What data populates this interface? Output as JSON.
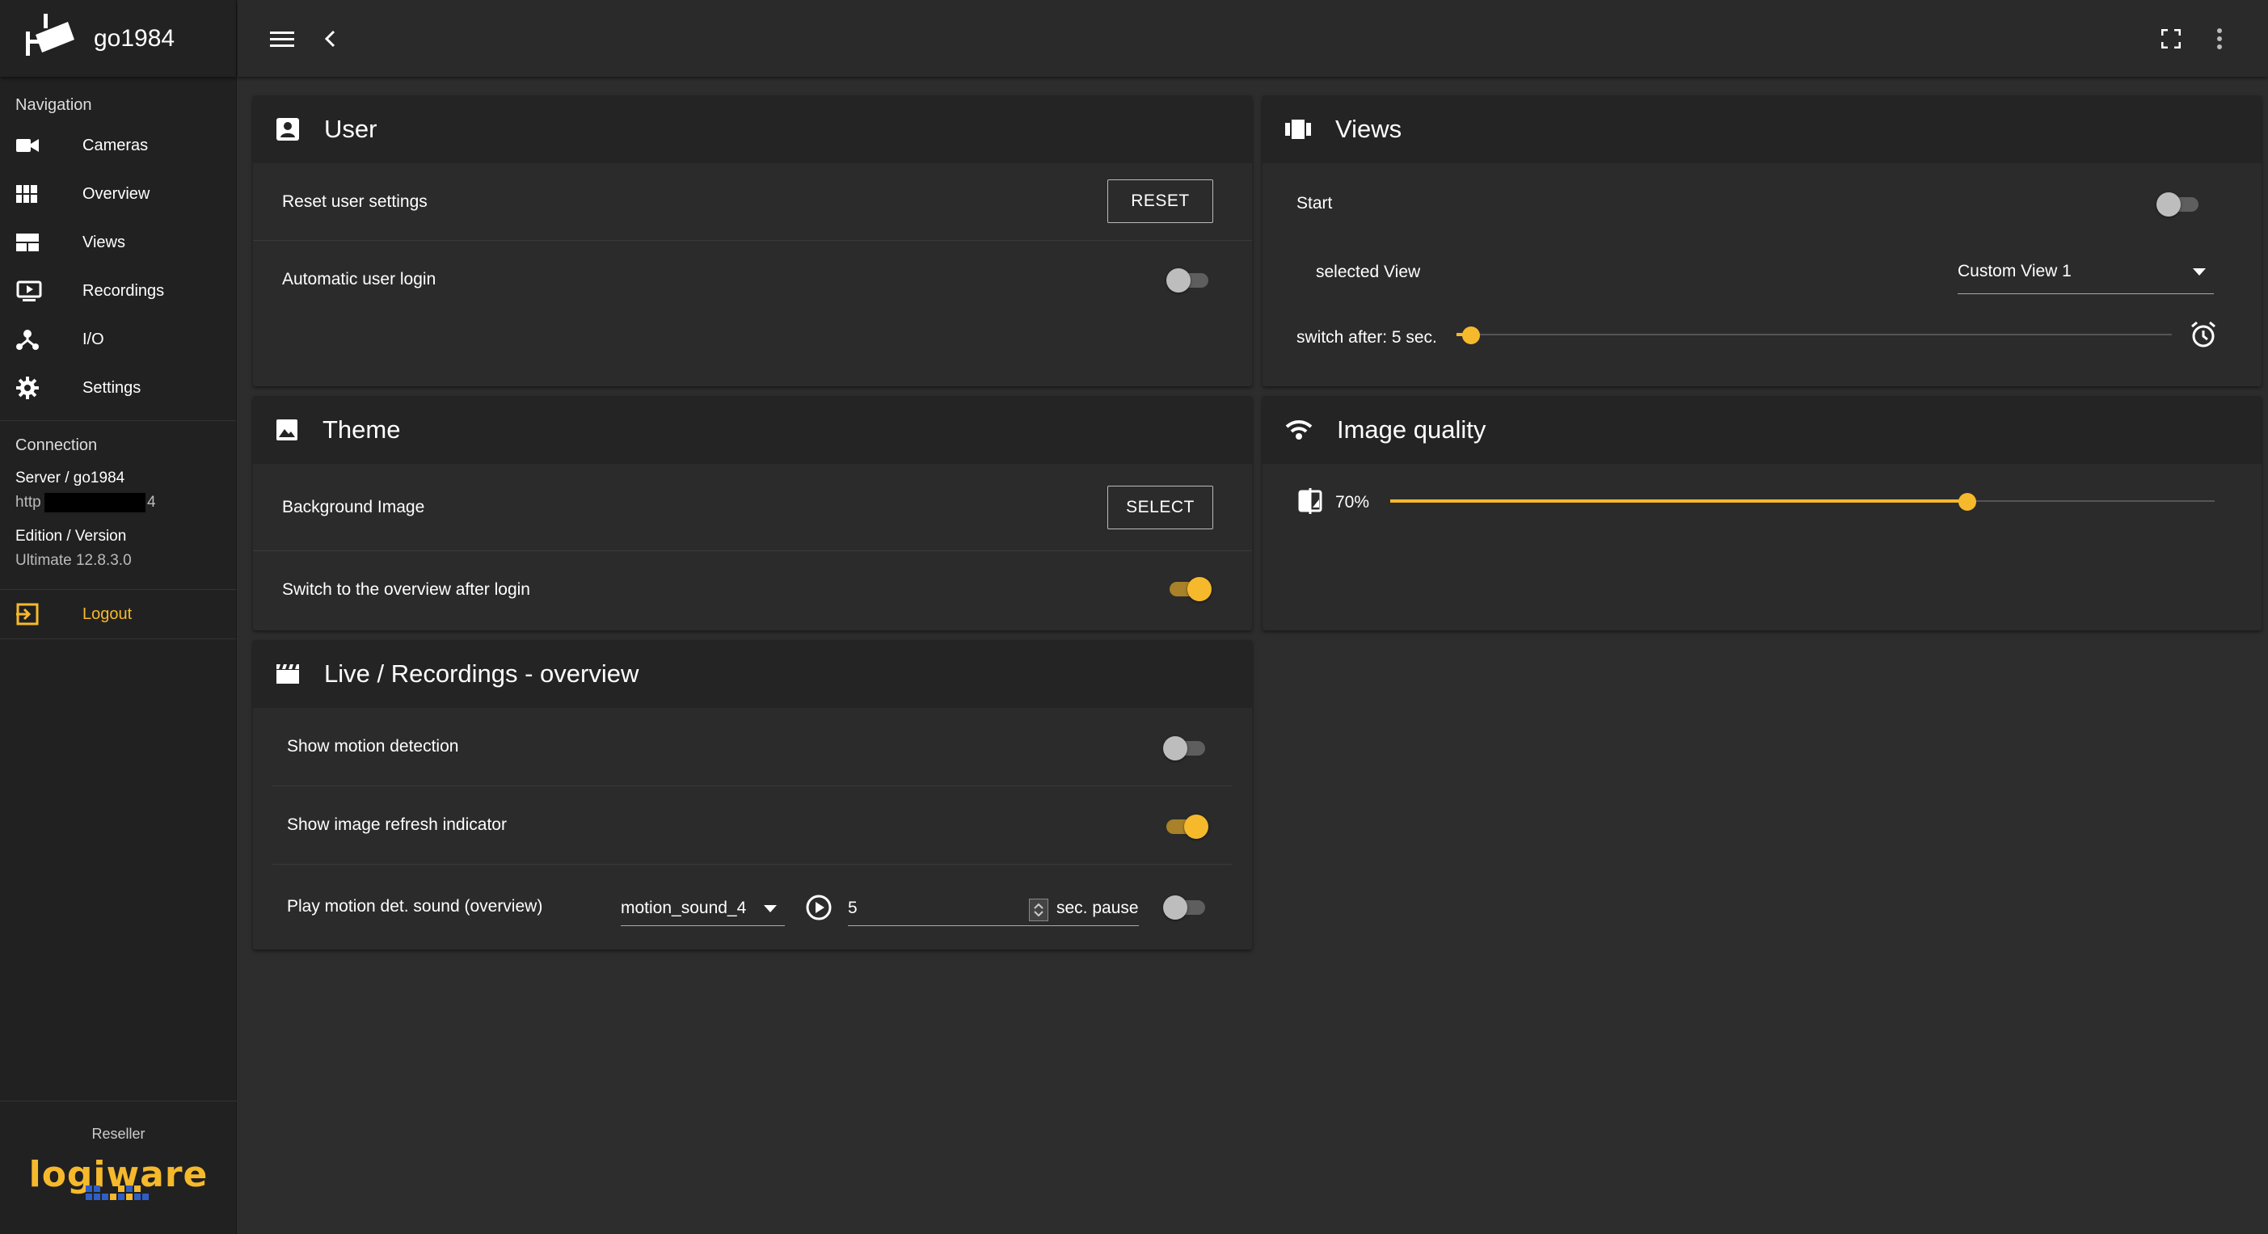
{
  "app": {
    "title": "go1984"
  },
  "sidebar": {
    "nav_label": "Navigation",
    "items": [
      {
        "label": "Cameras",
        "icon": "video-camera-icon"
      },
      {
        "label": "Overview",
        "icon": "grid-icon"
      },
      {
        "label": "Views",
        "icon": "view-layout-icon"
      },
      {
        "label": "Recordings",
        "icon": "recordings-icon"
      },
      {
        "label": "I/O",
        "icon": "io-network-icon"
      },
      {
        "label": "Settings",
        "icon": "gear-icon"
      }
    ],
    "connection_label": "Connection",
    "server_label": "Server / go1984",
    "server_url_start": "http",
    "server_url_end": "4",
    "edition_label": "Edition / Version",
    "edition_value": "Ultimate 12.8.3.0",
    "logout_label": "Logout",
    "reseller_label": "Reseller",
    "reseller_logo": {
      "text": "logiware",
      "colors": {
        "primary": "#f6b92c",
        "secondary": "#2f5fc4"
      }
    }
  },
  "user_card": {
    "title": "User",
    "reset_label": "Reset user settings",
    "reset_button": "RESET",
    "auto_login_label": "Automatic user login",
    "auto_login_on": false
  },
  "theme_card": {
    "title": "Theme",
    "bg_label": "Background Image",
    "select_button": "SELECT",
    "switch_label": "Switch to the overview after login",
    "switch_on": true
  },
  "live_card": {
    "title": "Live / Recordings - overview",
    "motion_label": "Show motion detection",
    "motion_on": false,
    "refresh_label": "Show image refresh indicator",
    "refresh_on": true,
    "sound_label": "Play motion det. sound (overview)",
    "sound_value": "motion_sound_4",
    "pause_value": "5",
    "pause_suffix": "sec. pause",
    "sound_on": false
  },
  "views_card": {
    "title": "Views",
    "start_label": "Start",
    "start_on": false,
    "selected_label": "selected View",
    "selected_value": "Custom View 1",
    "switch_label": "switch after: 5 sec.",
    "switch_fraction": 0.02
  },
  "quality_card": {
    "title": "Image quality",
    "value_label": "70%",
    "fraction": 0.7
  },
  "colors": {
    "accent": "#f6b92c",
    "background": "#2d2d2d",
    "sidebar": "#212121",
    "card": "#2b2b2b"
  }
}
